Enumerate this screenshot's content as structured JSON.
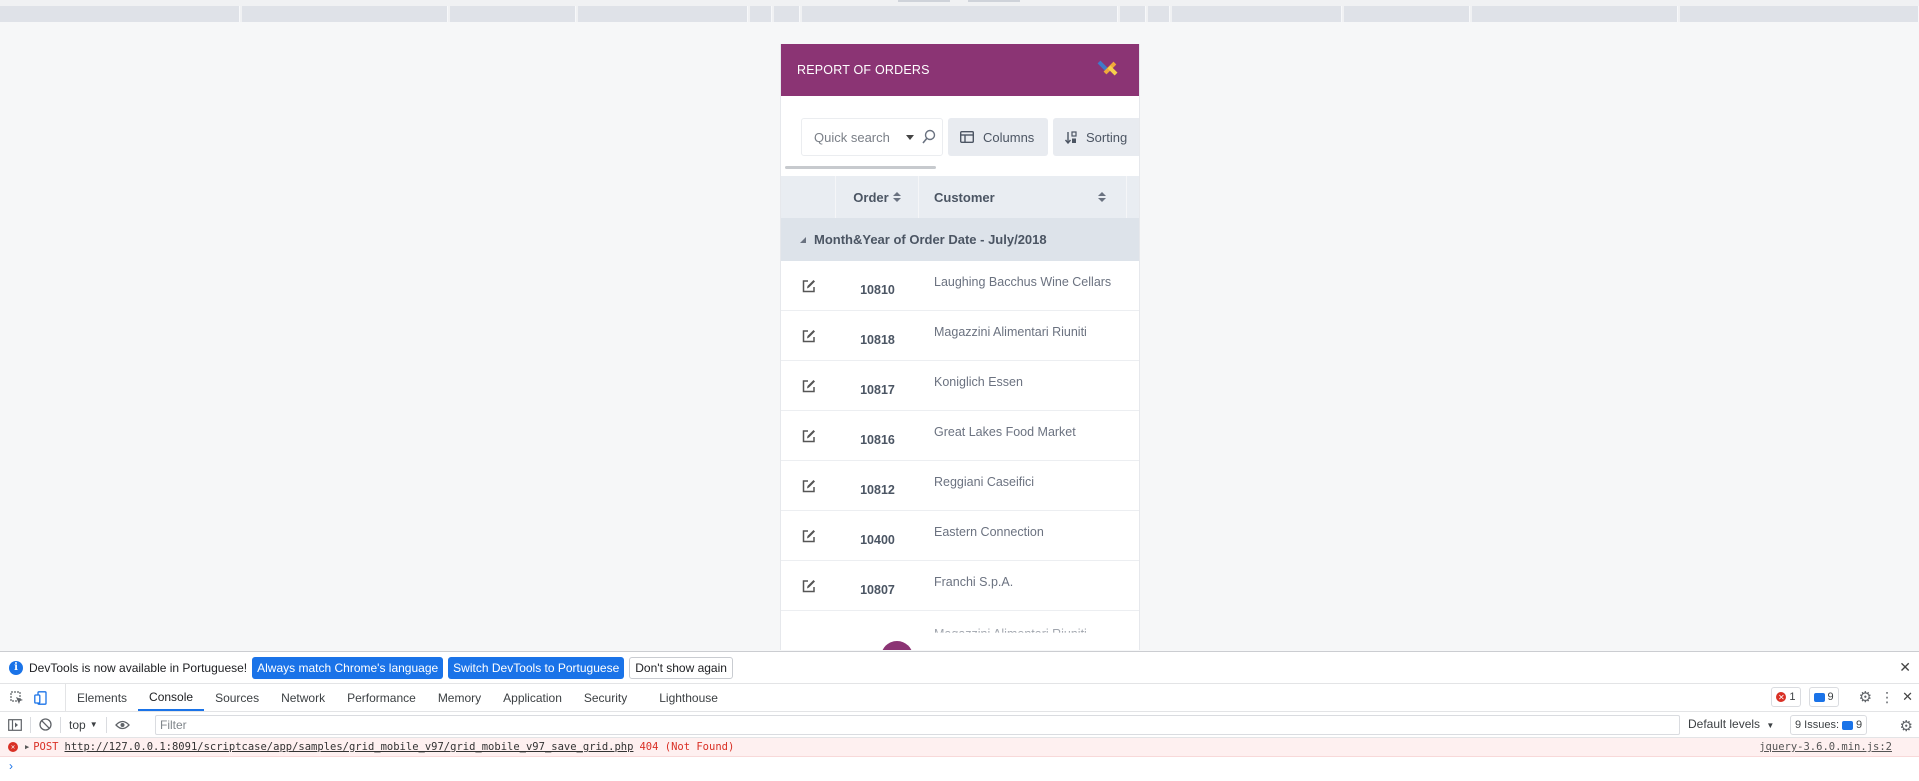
{
  "app": {
    "title": "REPORT OF ORDERS",
    "accent_color": "#8b3474",
    "toolbar": {
      "search_placeholder": "Quick search",
      "columns_label": "Columns",
      "sorting_label": "Sorting"
    },
    "table": {
      "headers": {
        "order": "Order",
        "customer": "Customer"
      },
      "group_label": "Month&Year of Order Date - July/2018",
      "rows": [
        {
          "order": "10810",
          "customer": "Laughing Bacchus Wine Cellars"
        },
        {
          "order": "10818",
          "customer": "Magazzini Alimentari Riuniti"
        },
        {
          "order": "10817",
          "customer": "Koniglich Essen"
        },
        {
          "order": "10816",
          "customer": "Great Lakes Food Market"
        },
        {
          "order": "10812",
          "customer": "Reggiani Caseifici"
        },
        {
          "order": "10400",
          "customer": "Eastern Connection"
        },
        {
          "order": "10807",
          "customer": "Franchi S.p.A."
        }
      ],
      "partial_row_customer": "Magazzini Alimentari Riuniti"
    }
  },
  "devtools": {
    "infobar": {
      "message": "DevTools is now available in Portuguese!",
      "btn_match": "Always match Chrome's language",
      "btn_switch": "Switch DevTools to Portuguese",
      "btn_dismiss": "Don't show again"
    },
    "tabs": [
      "Elements",
      "Console",
      "Sources",
      "Network",
      "Performance",
      "Memory",
      "Application",
      "Security",
      "Lighthouse"
    ],
    "active_tab": "Console",
    "error_count": "1",
    "message_count": "9",
    "context": "top",
    "filter_placeholder": "Filter",
    "levels_label": "Default levels",
    "issues_label": "9 Issues:",
    "issues_count": "9",
    "error_line": {
      "method": "POST",
      "url": "http://127.0.0.1:8091/scriptcase/app/samples/grid_mobile_v97/grid_mobile_v97_save_grid.php",
      "status": "404 (Not Found)",
      "source": "jquery-3.6.0.min.js:2"
    }
  }
}
